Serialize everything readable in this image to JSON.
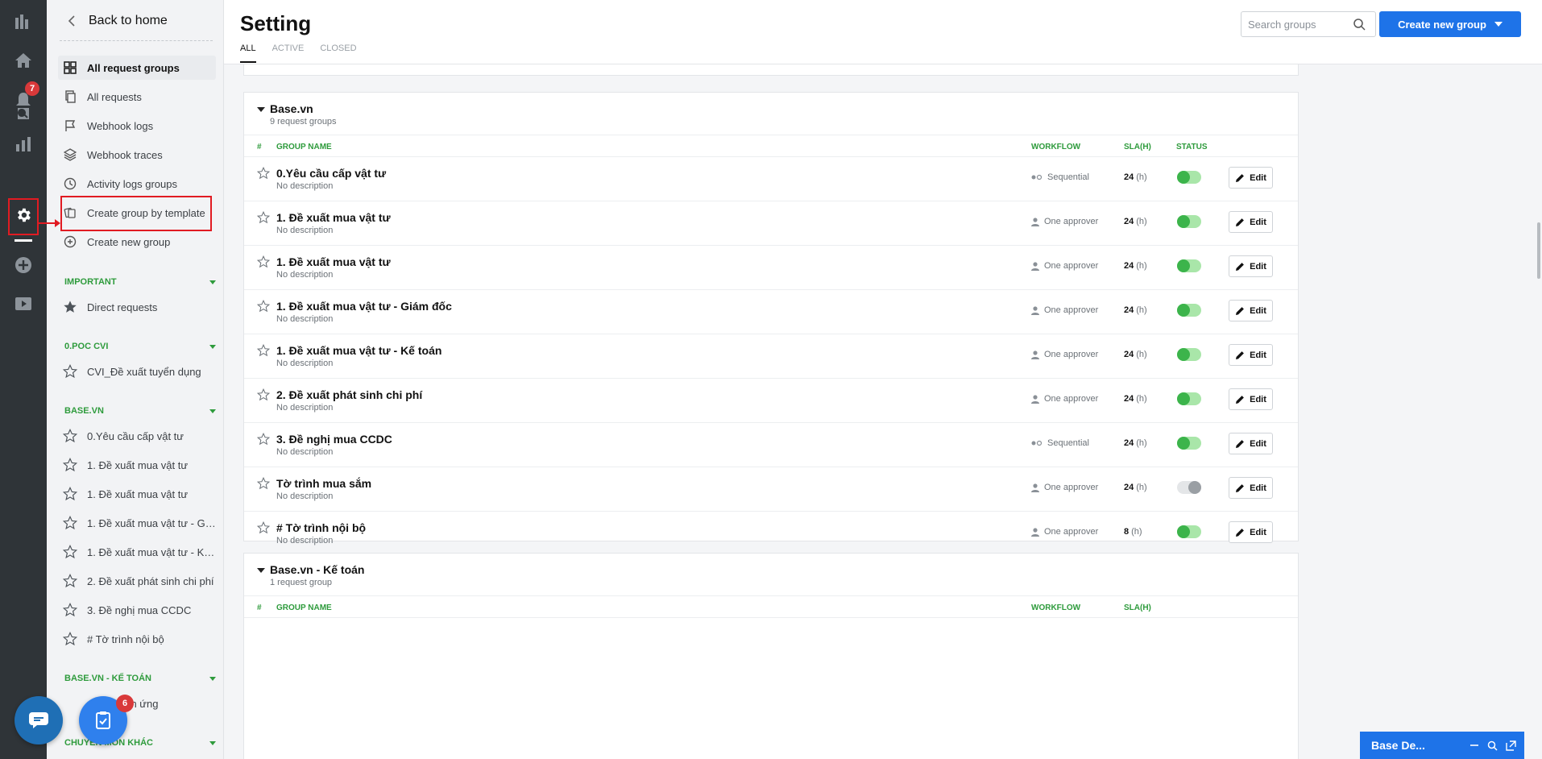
{
  "rail": {
    "notification_count": "7"
  },
  "sidebar": {
    "back_label": "Back to home",
    "nav": [
      {
        "label": "All request groups",
        "icon": "grid-icon"
      },
      {
        "label": "All requests",
        "icon": "copy-icon"
      },
      {
        "label": "Webhook logs",
        "icon": "flag-icon"
      },
      {
        "label": "Webhook traces",
        "icon": "layers-icon"
      },
      {
        "label": "Activity logs groups",
        "icon": "clock-icon"
      },
      {
        "label": "Create group by template",
        "icon": "template-icon"
      },
      {
        "label": "Create new group",
        "icon": "plus-circle-icon"
      }
    ],
    "sections": [
      {
        "title": "IMPORTANT",
        "items": [
          "Direct requests"
        ]
      },
      {
        "title": "0.POC CVI",
        "items": [
          "CVI_Đề xuất tuyển dụng"
        ]
      },
      {
        "title": "BASE.VN",
        "items": [
          "0.Yêu cầu cấp vật tư",
          "1. Đề xuất mua vật tư",
          "1. Đề xuất mua vật tư",
          "1. Đề xuất mua vật tư - Gi...",
          "1. Đề xuất mua vật tư - Kế...",
          "2. Đề xuất phát sinh chi phí",
          "3. Đề nghị mua CCDC",
          "# Tờ trình nội bộ"
        ]
      },
      {
        "title": "BASE.VN - KẾ TOÁN",
        "items": [
          "tạm ứng"
        ]
      },
      {
        "title": "CHUYÊN MÔN KHÁC",
        "items": []
      }
    ]
  },
  "floating": {
    "task_count": "6"
  },
  "header": {
    "title": "Setting",
    "tabs": [
      "ALL",
      "ACTIVE",
      "CLOSED"
    ],
    "search_placeholder": "Search groups",
    "create_label": "Create new group"
  },
  "table_headers": {
    "num": "#",
    "name": "GROUP NAME",
    "workflow": "WORKFLOW",
    "sla": "SLA(H)",
    "status": "STATUS"
  },
  "groups": [
    {
      "title": "Base.vn",
      "count": "9 request groups",
      "rows": [
        {
          "name": "0.Yêu cầu cấp vật tư",
          "desc": "No description",
          "workflow": "Sequential",
          "sla": "24",
          "unit": "(h)",
          "active": true,
          "edit": "Edit"
        },
        {
          "name": "1. Đề xuất mua vật tư",
          "desc": "No description",
          "workflow": "One approver",
          "sla": "24",
          "unit": "(h)",
          "active": true,
          "edit": "Edit"
        },
        {
          "name": "1. Đề xuất mua vật tư",
          "desc": "No description",
          "workflow": "One approver",
          "sla": "24",
          "unit": "(h)",
          "active": true,
          "edit": "Edit"
        },
        {
          "name": "1. Đề xuất mua vật tư - Giám đốc",
          "desc": "No description",
          "workflow": "One approver",
          "sla": "24",
          "unit": "(h)",
          "active": true,
          "edit": "Edit"
        },
        {
          "name": "1. Đề xuất mua vật tư - Kế toán",
          "desc": "No description",
          "workflow": "One approver",
          "sla": "24",
          "unit": "(h)",
          "active": true,
          "edit": "Edit"
        },
        {
          "name": "2. Đề xuất phát sinh chi phí",
          "desc": "No description",
          "workflow": "One approver",
          "sla": "24",
          "unit": "(h)",
          "active": true,
          "edit": "Edit"
        },
        {
          "name": "3. Đề nghị mua CCDC",
          "desc": "No description",
          "workflow": "Sequential",
          "sla": "24",
          "unit": "(h)",
          "active": true,
          "edit": "Edit"
        },
        {
          "name": "Tờ trình mua sắm",
          "desc": "No description",
          "workflow": "One approver",
          "sla": "24",
          "unit": "(h)",
          "active": false,
          "edit": "Edit"
        },
        {
          "name": "# Tờ trình nội bộ",
          "desc": "No description",
          "workflow": "One approver",
          "sla": "8",
          "unit": "(h)",
          "active": true,
          "edit": "Edit"
        }
      ]
    },
    {
      "title": "Base.vn - Kế toán",
      "count": "1 request group",
      "rows": []
    }
  ],
  "bottom_widget": {
    "label": "Base De..."
  }
}
